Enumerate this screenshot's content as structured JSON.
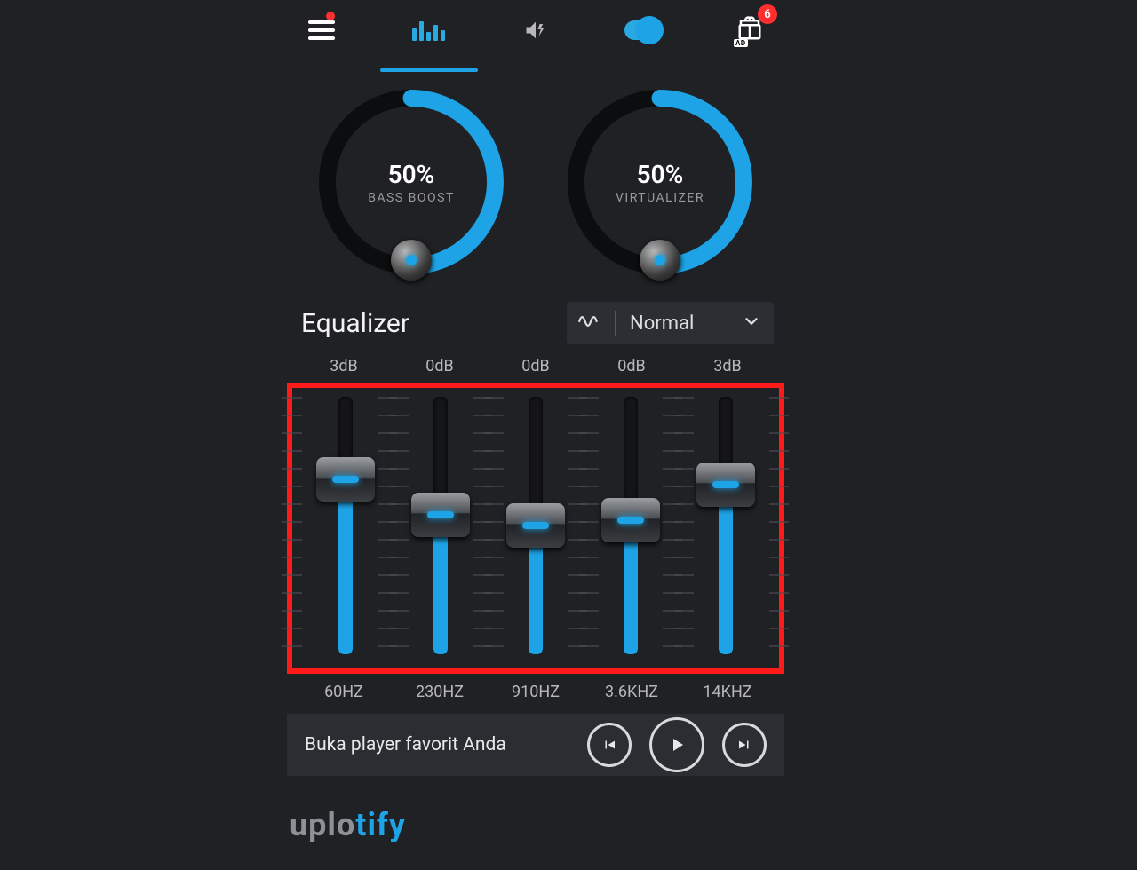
{
  "colors": {
    "accent": "#1ea4e6",
    "bg": "#1f2124",
    "highlight": "#ff1a1a"
  },
  "topbar": {
    "menu_has_notification": true,
    "gift_badge": "6",
    "gift_ad_label": "AD",
    "toggle_on": true
  },
  "knobs": {
    "bass": {
      "pct": "50%",
      "label": "BASS BOOST",
      "value": 50
    },
    "virtual": {
      "pct": "50%",
      "label": "VIRTUALIZER",
      "value": 50
    }
  },
  "equalizer": {
    "title": "Equalizer",
    "preset": "Normal",
    "db_labels": [
      "3dB",
      "0dB",
      "0dB",
      "0dB",
      "3dB"
    ],
    "freq_labels": [
      "60HZ",
      "230HZ",
      "910HZ",
      "3.6KHZ",
      "14KHZ"
    ],
    "bands": [
      {
        "freq": "60HZ",
        "db": 3,
        "fill_pct": 68
      },
      {
        "freq": "230HZ",
        "db": 0,
        "fill_pct": 54
      },
      {
        "freq": "910HZ",
        "db": 0,
        "fill_pct": 50
      },
      {
        "freq": "3.6KHZ",
        "db": 0,
        "fill_pct": 52
      },
      {
        "freq": "14KHZ",
        "db": 3,
        "fill_pct": 66
      }
    ]
  },
  "player": {
    "now_playing_text": "Buka player favorit Anda"
  },
  "watermark": {
    "part1": "uplo",
    "part2": "tify"
  }
}
